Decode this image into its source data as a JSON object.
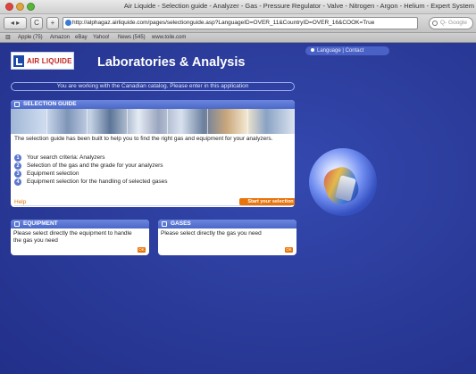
{
  "window": {
    "title": "Air Liquide - Selection guide - Analyzer - Gas - Pressure Regulator - Valve - Nitrogen - Argon - Helium - Expert System"
  },
  "toolbar": {
    "back_label": "◂ ▸",
    "reload_label": "C",
    "add_label": "+",
    "url": "http://alphagaz.airliquide.com/pages/selectionguide.asp?LanguageID=OVER_11&CountryID=OVER_16&COOK=True",
    "search_placeholder": "Q- Google"
  },
  "bookmarks": {
    "items": [
      "Apple (75)",
      "Amazon",
      "eBay",
      "Yahoo!",
      "News (545)",
      "www.toile.com"
    ]
  },
  "site": {
    "logo_text": "AIR LIQUIDE",
    "title": "Laboratories & Analysis",
    "top_links": "Language | Contact",
    "catalog_notice": "You are working with the Canadian catalog. Please enter in this application"
  },
  "selection_guide": {
    "header": "SELECTION GUIDE",
    "description": "The selection guide has been built to help you to find the right gas and equipment for your analyzers.",
    "steps": [
      {
        "num": "1",
        "label": "Your search criteria: Analyzers"
      },
      {
        "num": "2",
        "label": "Selection of the gas and the grade for your analyzers"
      },
      {
        "num": "3",
        "label": "Equipment selection"
      },
      {
        "num": "4",
        "label": "Equipment selection for the handling of selected gases"
      }
    ],
    "help_label": "Help",
    "start_label": "Start your selection"
  },
  "equipment": {
    "header": "EQUIPMENT",
    "body": "Please select directly the equipment to handle the gas you need",
    "ok_label": "OK"
  },
  "gases": {
    "header": "GASES",
    "body": "Please select directly the gas you need",
    "ok_label": "OK"
  },
  "colors": {
    "page_bg": "#2b3d9a",
    "panel_header": "#5a76cf",
    "accent_orange": "#e8740a",
    "logo_red": "#c4241f"
  }
}
